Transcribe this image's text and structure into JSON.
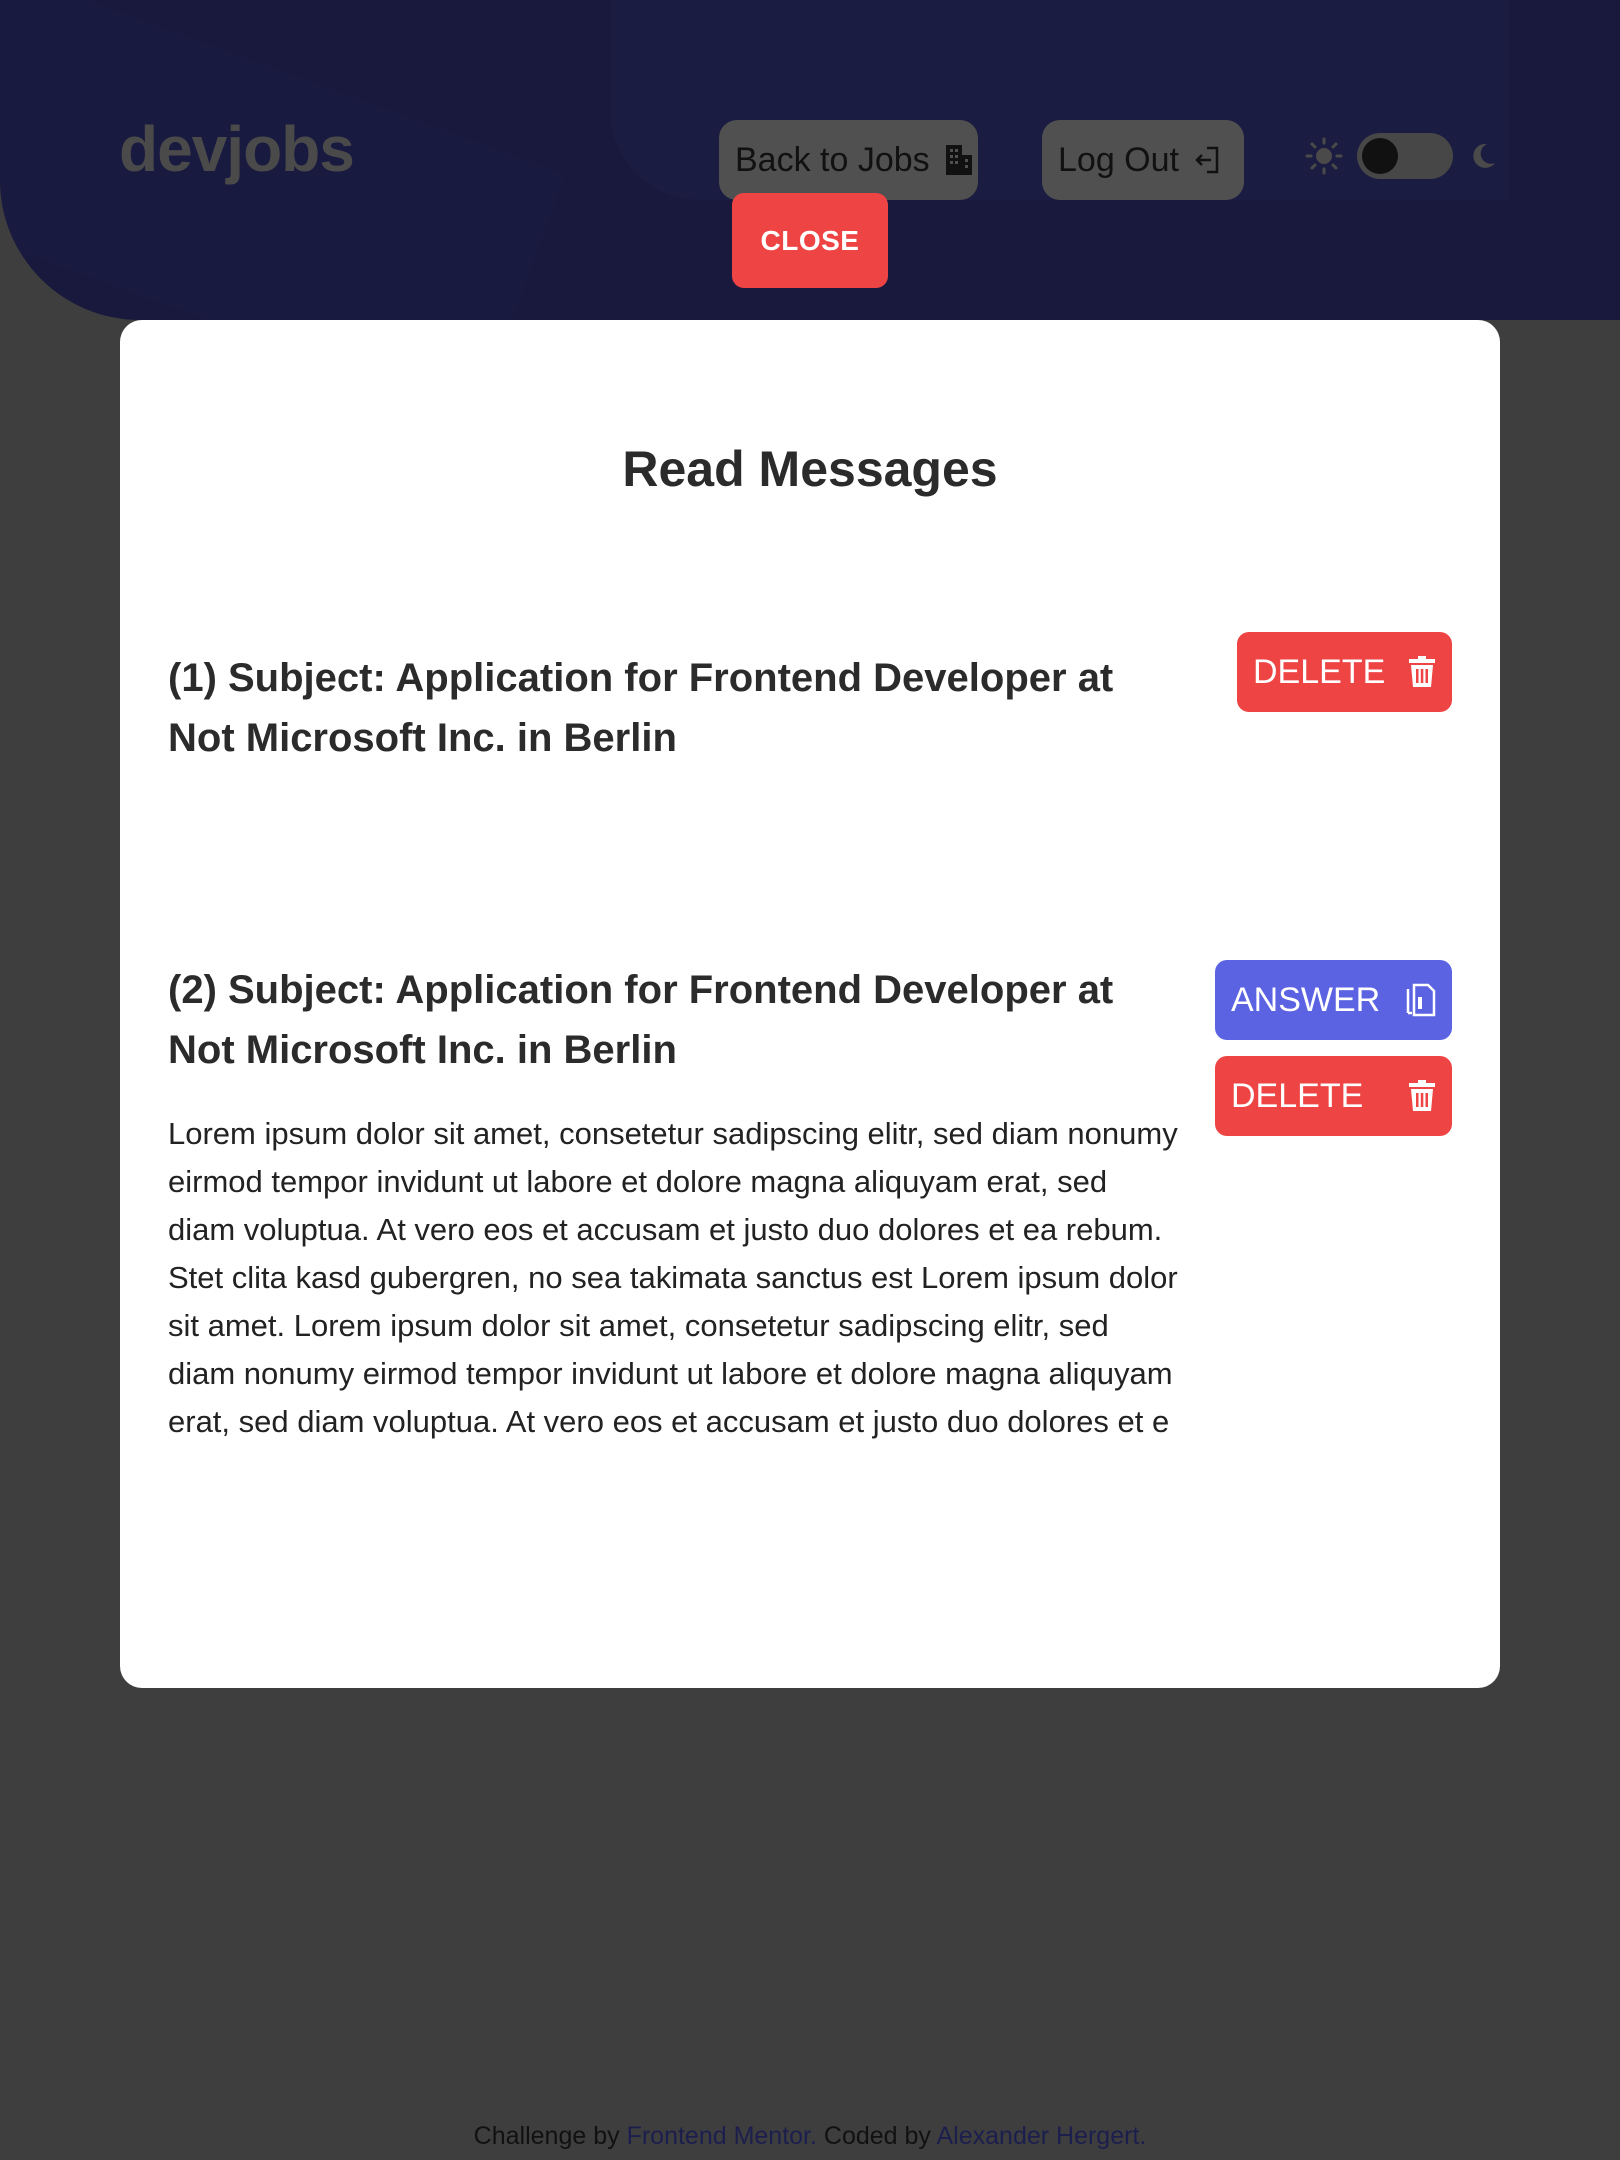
{
  "header": {
    "logo": "devjobs",
    "back_label": "Back to Jobs",
    "logout_label": "Log Out",
    "close_label": "CLOSE"
  },
  "modal": {
    "title": "Read Messages",
    "messages": [
      {
        "subject": "(1)  Subject: Application for Frontend Developer at Not Microsoft Inc. in Berlin",
        "delete_label": "DELETE"
      },
      {
        "subject": "(2)  Subject: Application for Frontend Developer at Not Microsoft Inc. in Berlin",
        "body": "Lorem ipsum dolor sit amet, consetetur sadipscing elitr, sed diam nonumy eirmod tempor invidunt ut labore et dolore magna aliquyam erat, sed diam voluptua. At vero eos et accusam et justo duo dolores et ea rebum. Stet clita kasd gubergren, no sea takimata sanctus est Lorem ipsum dolor sit amet. Lorem ipsum dolor sit amet, consetetur sadipscing elitr, sed diam nonumy eirmod tempor invidunt ut labore et dolore magna aliquyam erat, sed diam voluptua. At vero eos et accusam et justo duo dolores et e",
        "answer_label": "ANSWER",
        "delete_label": "DELETE"
      }
    ]
  },
  "footer": {
    "prefix": "Challenge by ",
    "link1": "Frontend Mentor.",
    "middle": " Coded by ",
    "link2": "Alexander Hergert."
  },
  "colors": {
    "header_bg": "#19193e",
    "overlay": "#3e3e3e",
    "danger": "#ef4444",
    "primary": "#5b63e3"
  },
  "icons": [
    "building-icon",
    "logout-icon",
    "sun-icon",
    "moon-icon",
    "trash-icon",
    "document-icon"
  ]
}
